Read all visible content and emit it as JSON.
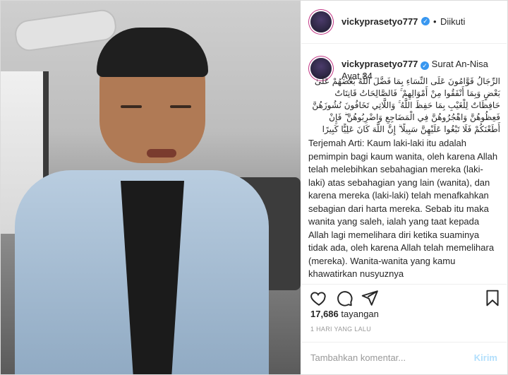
{
  "header": {
    "username": "vickyprasetyo777",
    "separator": "•",
    "follow_status": "Diikuti"
  },
  "caption": {
    "username": "vickyprasetyo777",
    "intro": "Surat An-Nisa Ayat 34",
    "arabic": "الرِّجَالُ قَوَّامُونَ عَلَى النِّسَاءِ بِمَا فَضَّلَ اللَّهُ بَعْضَهُمْ عَلَىٰ بَعْضٍ وَبِمَا أَنْفَقُوا مِنْ أَمْوَالِهِمْ ۚ فَالصَّالِحَاتُ قَانِتَاتٌ حَافِظَاتٌ لِلْغَيْبِ بِمَا حَفِظَ اللَّهُ ۚ وَاللَّاتِي تَخَافُونَ نُشُوزَهُنَّ فَعِظُوهُنَّ وَاهْجُرُوهُنَّ فِي الْمَضَاجِعِ وَاضْرِبُوهُنَّ ۖ فَإِنْ أَطَعْنَكُمْ فَلَا تَبْغُوا عَلَيْهِنَّ سَبِيلًا ۗ إِنَّ اللَّهَ كَانَ عَلِيًّا كَبِيرًا",
    "translation": "Terjemah Arti: Kaum laki-laki itu adalah pemimpin bagi kaum wanita, oleh karena Allah telah melebihkan sebahagian mereka (laki-laki) atas sebahagian yang lain (wanita), dan karena mereka (laki-laki) telah menafkahkan sebagian dari harta mereka. Sebab itu maka wanita yang saleh, ialah yang taat kepada Allah lagi memelihara diri ketika suaminya tidak ada, oleh karena Allah telah memelihara (mereka). Wanita-wanita yang kamu khawatirkan nusyuznya"
  },
  "actions": {
    "like_icon": "heart-icon",
    "comment_icon": "comment-icon",
    "share_icon": "share-icon",
    "save_icon": "bookmark-icon"
  },
  "stats": {
    "views_count": "17,686",
    "views_label": "tayangan",
    "time": "1 HARI YANG LALU"
  },
  "comment": {
    "placeholder": "Tambahkan komentar...",
    "post_label": "Kirim"
  },
  "colors": {
    "verified": "#3897f0",
    "post_disabled": "#b2dffc"
  }
}
